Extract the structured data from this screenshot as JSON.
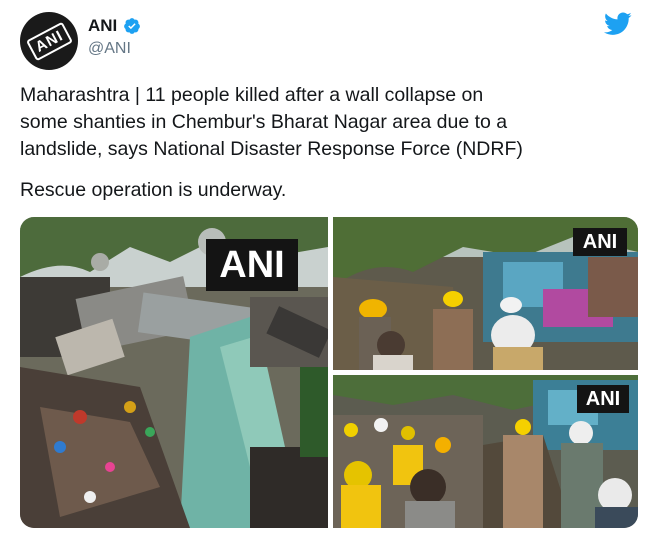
{
  "account": {
    "display_name": "ANI",
    "handle": "@ANI",
    "avatar_text": "ANI",
    "verified": true
  },
  "tweet": {
    "text": "Maharashtra | 11 people killed after a wall collapse on\nsome shanties in Chembur's Bharat Nagar area due to a\nlandslide, says National Disaster Response Force (NDRF)",
    "rescue_line": "Rescue operation is underway."
  },
  "media": {
    "watermarks": [
      "ANI",
      "ANI",
      "ANI"
    ]
  },
  "colors": {
    "twitter_blue": "#1DA1F2",
    "verified_blue": "#1DA1F2",
    "handle_gray": "#657786"
  }
}
